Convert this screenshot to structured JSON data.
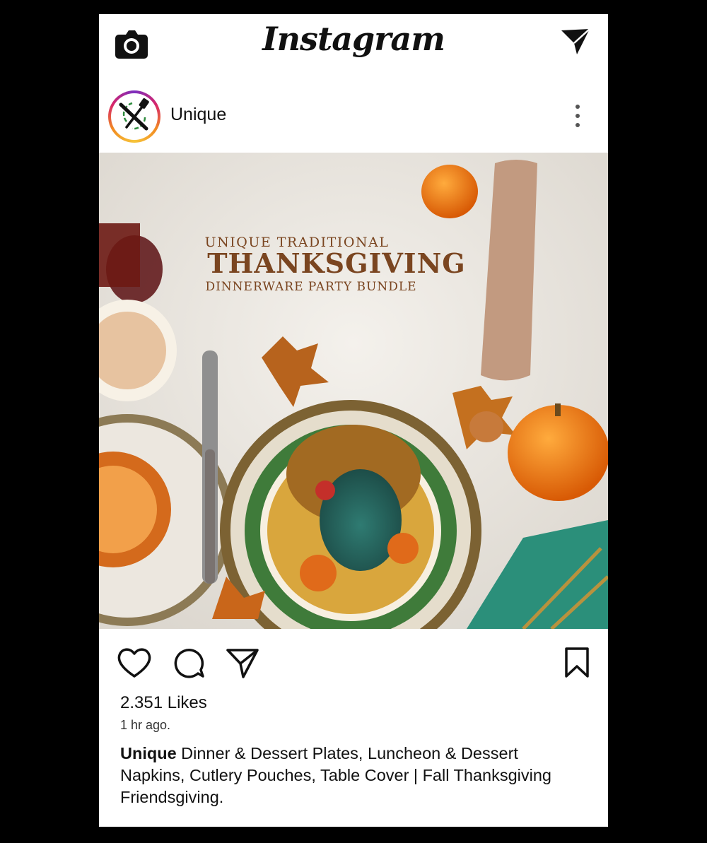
{
  "app": {
    "title": "Instagram"
  },
  "topbar": {
    "camera_icon": "camera-icon",
    "send_icon": "send-icon"
  },
  "profile": {
    "username": "Unique",
    "more_icon": "more-vertical-icon"
  },
  "post": {
    "image_text": {
      "line1": "UNIQUE TRADITIONAL",
      "line2": "THANKSGIVING",
      "line3": "DINNERWARE PARTY BUNDLE"
    }
  },
  "actions": {
    "like_icon": "heart-icon",
    "comment_icon": "comment-icon",
    "share_icon": "send-icon",
    "save_icon": "bookmark-icon"
  },
  "likes": "2.351 Likes",
  "time": "1 hr ago.",
  "caption": {
    "author": "Unique",
    "text": " Dinner & Dessert Plates, Luncheon & Dessert Napkins, Cutlery Pouches, Table Cover | Fall Thanksgiving Friendsgiving."
  }
}
